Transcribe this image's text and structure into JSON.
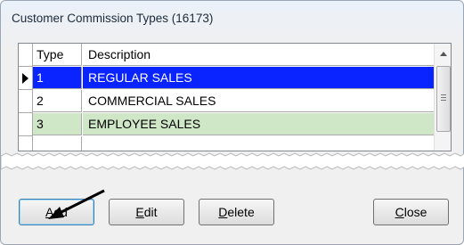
{
  "window": {
    "title": "Customer Commission Types (16173)"
  },
  "grid": {
    "columns": [
      "Type",
      "Description"
    ],
    "rows": [
      {
        "type": "1",
        "description": "REGULAR SALES",
        "selected": true
      },
      {
        "type": "2",
        "description": "COMMERCIAL SALES",
        "selected": false
      },
      {
        "type": "3",
        "description": "EMPLOYEE SALES",
        "selected": false
      }
    ]
  },
  "buttons": {
    "add": {
      "mnemonic": "A",
      "rest": "dd"
    },
    "edit": {
      "mnemonic": "E",
      "rest": "dit"
    },
    "delete": {
      "mnemonic": "D",
      "rest": "elete"
    },
    "close": {
      "mnemonic": "C",
      "rest": "lose"
    }
  },
  "colors": {
    "selected_row": "#0a24ff",
    "alternate_row": "#cfe6c7",
    "window_border": "#9aa6b4"
  }
}
